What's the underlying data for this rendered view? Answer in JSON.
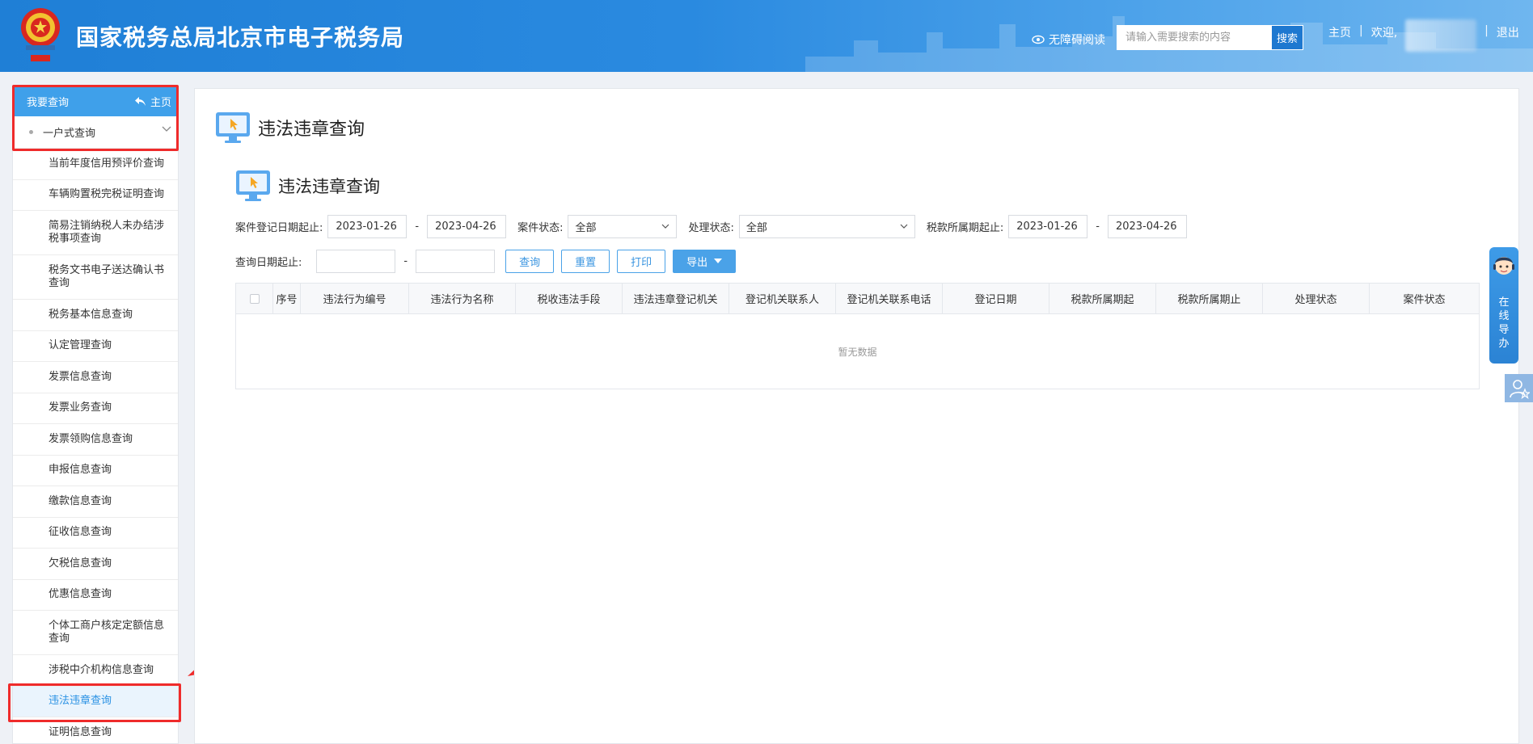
{
  "header": {
    "site_title": "国家税务总局北京市电子税务局",
    "accessibility_label": "无障碍阅读",
    "search_placeholder": "请输入需要搜索的内容",
    "search_button": "搜索",
    "home_link": "主页",
    "welcome": "欢迎,",
    "logout_link": "退出",
    "separator": "|"
  },
  "sidebar": {
    "section_title": "我要查询",
    "home_label": "主页",
    "group_label": "一户式查询",
    "items": [
      "当前年度信用预评价查询",
      "车辆购置税完税证明查询",
      "简易注销纳税人未办结涉税事项查询",
      "税务文书电子送达确认书查询",
      "税务基本信息查询",
      "认定管理查询",
      "发票信息查询",
      "发票业务查询",
      "发票领购信息查询",
      "申报信息查询",
      "缴款信息查询",
      "征收信息查询",
      "欠税信息查询",
      "优惠信息查询",
      "个体工商户核定定额信息查询",
      "涉税中介机构信息查询",
      "违法违章查询",
      "证明信息查询"
    ],
    "active_index": 16
  },
  "main": {
    "page_title": "违法违章查询",
    "sub_title": "违法违章查询",
    "filters": {
      "case_date_label": "案件登记日期起止:",
      "case_date_start": "2023-01-26",
      "case_date_end": "2023-04-26",
      "dash": "-",
      "case_status_label": "案件状态:",
      "case_status_value": "全部",
      "handle_status_label": "处理状态:",
      "handle_status_value": "全部",
      "tax_period_label": "税款所属期起止:",
      "tax_period_start": "2023-01-26",
      "tax_period_end": "2023-04-26",
      "query_date_label": "查询日期起止:",
      "query_date_start": "",
      "query_date_end": ""
    },
    "buttons": {
      "query": "查询",
      "reset": "重置",
      "print": "打印",
      "export": "导出"
    },
    "table": {
      "columns": [
        "序号",
        "违法行为编号",
        "违法行为名称",
        "税收违法手段",
        "违法违章登记机关",
        "登记机关联系人",
        "登记机关联系电话",
        "登记日期",
        "税款所属期起",
        "税款所属期止",
        "处理状态",
        "案件状态"
      ],
      "empty_text": "暂无数据"
    }
  },
  "float": {
    "online_label_chars": [
      "在",
      "线",
      "导",
      "办"
    ]
  },
  "colors": {
    "header_blue": "#1f7fd6",
    "sidebar_accent": "#3fa0ea",
    "active_text": "#2b92e4",
    "annotation_red": "#ef2b2b"
  }
}
